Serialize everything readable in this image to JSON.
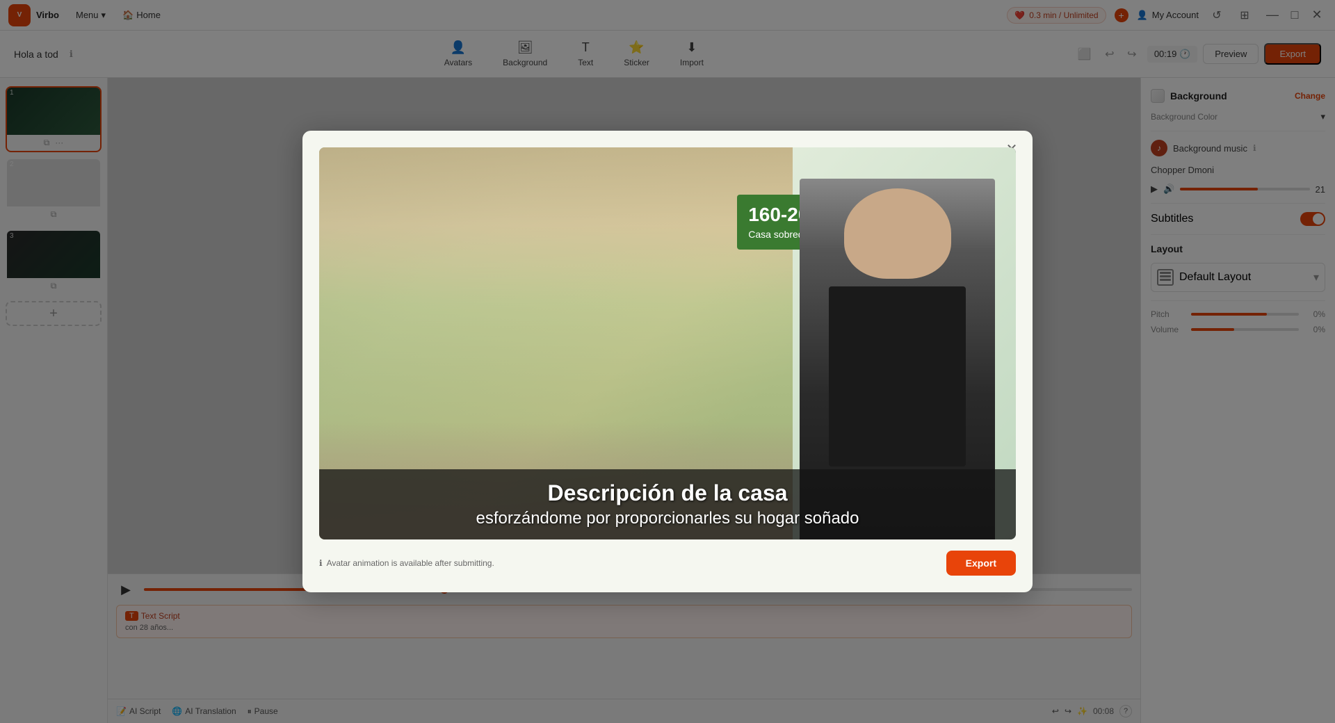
{
  "app": {
    "logo_text": "Virbo",
    "menu_label": "Menu",
    "home_label": "Home",
    "project_title": "Hola a tod",
    "usage": "0.3 min / Unlimited",
    "account_label": "My Account",
    "time_display": "00:19",
    "preview_label": "Preview",
    "export_label": "Export",
    "undo_symbol": "↩",
    "redo_symbol": "↪"
  },
  "toolbar": {
    "avatars_label": "Avatars",
    "background_label": "Background",
    "text_label": "Text",
    "sticker_label": "Sticker",
    "import_label": "Import"
  },
  "slides": [
    {
      "number": "1",
      "active": true
    },
    {
      "number": "2",
      "active": false
    },
    {
      "number": "3",
      "active": false
    }
  ],
  "add_slide_symbol": "+",
  "timeline": {
    "play_symbol": "▶",
    "time_current": "00:08",
    "progress_percent": 30
  },
  "text_script": {
    "label": "Text Script",
    "content": "con 28 años..."
  },
  "bottom_toolbar": {
    "ai_script_label": "AI Script",
    "ai_translation_label": "AI Translation",
    "pause_label": "Pause",
    "time_label": "00:08",
    "help_symbol": "?"
  },
  "right_sidebar": {
    "section_title": "Background",
    "change_label": "Change",
    "bg_color_label": "Background Color",
    "bg_music_label": "Background music",
    "music_name": "Chopper Dmoni",
    "volume_value": "21",
    "subtitles_label": "Subtitles",
    "layout_label": "Layout",
    "default_layout_label": "Default Layout",
    "pitch_label": "Pitch",
    "pitch_value": "0%",
    "volume_label": "Volume",
    "volume_label2": "0%"
  },
  "modal": {
    "preview_green_title": "160-208m²",
    "preview_green_sub": "Casa sobredimensionada",
    "subtitle_line1": "Descripción de la casa",
    "subtitle_line2": "esforzándome por proporcionarles su hogar soñado",
    "info_text": "Avatar animation is available after submitting.",
    "export_label": "Export",
    "close_symbol": "✕"
  },
  "icons": {
    "home": "🏠",
    "dropdown_arrow": "▾",
    "info": "ℹ",
    "settings": "⚙",
    "grid": "⊞",
    "minimize": "—",
    "maximize": "□",
    "close": "✕",
    "avatar": "👤",
    "music": "♪",
    "layout": "⊟",
    "play": "▶",
    "refresh": "↺",
    "clock": "🕐",
    "undo": "↩",
    "redo": "↪",
    "script": "📝",
    "globe": "🌐",
    "pause": "⏸",
    "volume": "🔊",
    "chevron_down": "▾"
  }
}
